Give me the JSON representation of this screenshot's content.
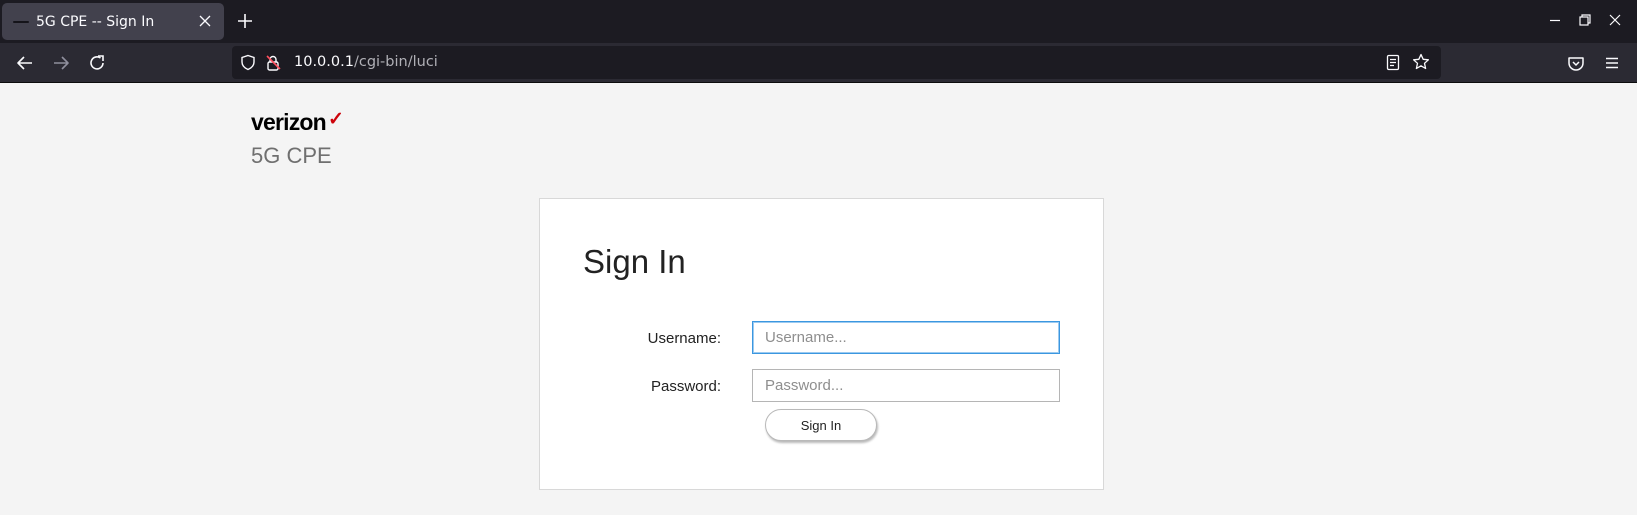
{
  "browser": {
    "tab": {
      "title": "5G CPE -- Sign In"
    },
    "url": {
      "host": "10.0.0.1",
      "path": "/cgi-bin/luci"
    }
  },
  "icons": {
    "tab_close": "close-icon",
    "new_tab": "plus-icon",
    "minimize": "minimize-icon",
    "restore": "restore-icon",
    "close_window": "close-window-icon",
    "back": "arrow-left-icon",
    "forward": "arrow-right-icon",
    "reload": "reload-icon",
    "tracking": "shield-icon",
    "connection": "insecure-lock-icon",
    "reader": "reader-view-icon",
    "bookmark": "star-icon",
    "pocket": "pocket-icon",
    "menu": "hamburger-menu-icon"
  },
  "brand": {
    "logo": "verizon",
    "check": "✓",
    "product": "5G CPE"
  },
  "login": {
    "title": "Sign In",
    "username_label": "Username:",
    "username_value": "",
    "username_placeholder": "Username...",
    "password_label": "Password:",
    "password_value": "",
    "password_placeholder": "Password...",
    "submit_label": "Sign In"
  },
  "colors": {
    "brand_red": "#cd040b",
    "focus_blue": "#3b97e0",
    "tabbar_bg": "#1c1b22",
    "navbar_bg": "#2b2a33",
    "page_bg": "#f4f4f4"
  }
}
